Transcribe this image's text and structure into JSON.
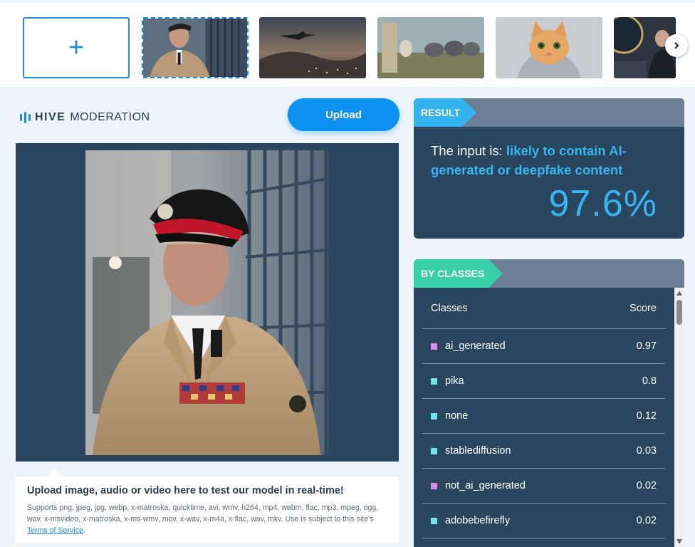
{
  "strip": {
    "add_label": "+",
    "thumbnails": [
      "officer",
      "plane-city",
      "elephants",
      "cat",
      "podium"
    ]
  },
  "brand": {
    "strong": "HIVE",
    "light": "MODERATION"
  },
  "upload_label": "Upload",
  "info": {
    "headline": "Upload image, audio or video here to test our model in real-time!",
    "fine_text": "Supports png, jpeg, jpg, webp, x-matroska, quicktime, avi, wmv, h264, mp4, webm, flac, mp3, mpeg, ogg, wav, x-msvideo, x-matroska, x-ms-wmv, mov, x-wav, x-m4a, x-flac, wav, mkv. Use is subject to this site's",
    "tos_link": "Terms of Service",
    "tos_suffix": "."
  },
  "result": {
    "tag": "RESULT",
    "prefix": "The input is: ",
    "verdict": "likely to contain AI-generated or deepfake content",
    "percent": "97.6%"
  },
  "classes": {
    "tag": "BY CLASSES",
    "col_class": "Classes",
    "col_score": "Score",
    "rows": [
      {
        "name": "ai_generated",
        "score": "0.97",
        "color": "#d98be8"
      },
      {
        "name": "pika",
        "score": "0.8",
        "color": "#6ee7e0"
      },
      {
        "name": "none",
        "score": "0.12",
        "color": "#6ee7e0"
      },
      {
        "name": "stablediffusion",
        "score": "0.03",
        "color": "#6ee7e0"
      },
      {
        "name": "not_ai_generated",
        "score": "0.02",
        "color": "#d98be8"
      },
      {
        "name": "adobebefirefly",
        "score": "0.02",
        "color": "#6ee7e0"
      }
    ]
  },
  "colors": {
    "accent": "#0c93f2",
    "panel": "#2a465e",
    "result_tag": "#33b3f0",
    "classes_tag": "#38d0a9"
  }
}
